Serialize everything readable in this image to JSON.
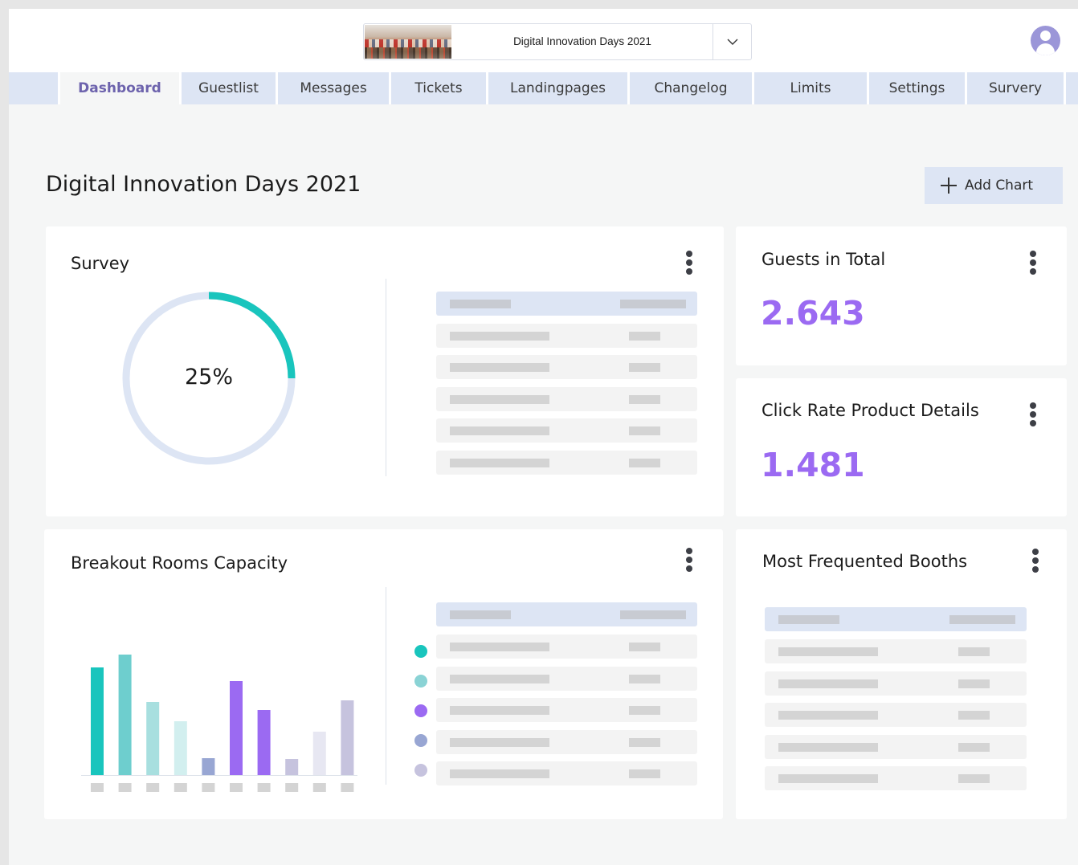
{
  "header": {
    "event_selector": {
      "value": "Digital Innovation Days 2021"
    },
    "caret_icon": "chevron-down-icon",
    "avatar_icon": "user-avatar-icon"
  },
  "tabs": [
    {
      "label": "Dashboard",
      "active": true
    },
    {
      "label": "Guestlist"
    },
    {
      "label": "Messages"
    },
    {
      "label": "Tickets"
    },
    {
      "label": "Landingpages"
    },
    {
      "label": "Changelog"
    },
    {
      "label": "Limits"
    },
    {
      "label": "Settings"
    },
    {
      "label": "Survery"
    }
  ],
  "page": {
    "title": "Digital Innovation Days 2021",
    "add_chart_label": "Add Chart"
  },
  "cards": {
    "survey": {
      "title": "Survey",
      "percent_label": "25%",
      "progress": 0.25,
      "table_rows": 5
    },
    "guests_total": {
      "title": "Guests in Total",
      "value": "2.643"
    },
    "click_rate": {
      "title": "Click Rate Product Details",
      "value": "1.481"
    },
    "breakout": {
      "title": "Breakout Rooms Capacity",
      "table_rows": 5
    },
    "booths": {
      "title": "Most Frequented Booths",
      "table_rows": 5
    }
  },
  "chart_data": {
    "type": "bar",
    "categories": [
      "",
      "",
      "",
      "",
      "",
      "",
      "",
      "",
      "",
      ""
    ],
    "values": [
      134,
      150,
      91,
      67,
      21,
      117,
      81,
      20,
      54,
      93
    ],
    "bar_colors": [
      "#19c5bd",
      "#6ecece",
      "#a8dfdf",
      "#d2efef",
      "#98a6d3",
      "#9b6af2",
      "#9b6af2",
      "#c6c3de",
      "#e7e7f2",
      "#c6c3de"
    ],
    "legend_colors": [
      "#19c5bd",
      "#8ad3d5",
      "#9b6af2",
      "#98a6d3",
      "#c6c3de"
    ],
    "ylim": [
      0,
      160
    ],
    "grid": false
  },
  "colors": {
    "accent_teal": "#19c5bd",
    "accent_purple": "#9b6af2",
    "tab_bg": "#dde5f4",
    "active_tab_text": "#6d63ad"
  }
}
